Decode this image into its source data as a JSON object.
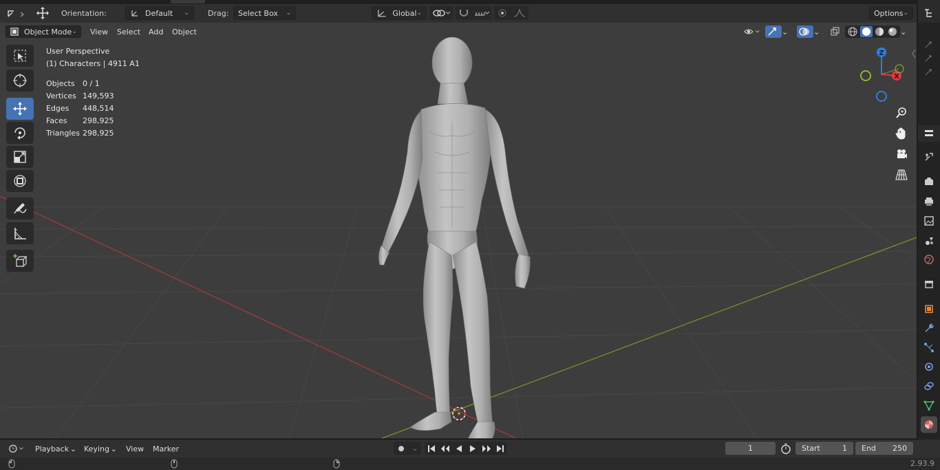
{
  "header": {
    "orientation_label": "Orientation:",
    "orientation_value": "Default",
    "drag_label": "Drag:",
    "drag_value": "Select Box",
    "transform_space": "Global",
    "options_label": "Options"
  },
  "viewport_header": {
    "mode": "Object Mode",
    "menus": [
      "View",
      "Select",
      "Add",
      "Object"
    ]
  },
  "overlay": {
    "view_name": "User Perspective",
    "collection": "(1) Characters | 4911 A1",
    "stats": [
      {
        "label": "Objects",
        "value": "0 / 1"
      },
      {
        "label": "Vertices",
        "value": "149,593"
      },
      {
        "label": "Edges",
        "value": "448,514"
      },
      {
        "label": "Faces",
        "value": "298,925"
      },
      {
        "label": "Triangles",
        "value": "298,925"
      }
    ]
  },
  "gizmo": {
    "z_label": "Z",
    "x_label": "X",
    "colors": {
      "x": "#e8334a",
      "y": "#8bb82b",
      "z": "#2b7fe0"
    }
  },
  "toolbar": {
    "tools": [
      "select-box-tool",
      "cursor-tool",
      "move-tool",
      "rotate-tool",
      "scale-tool",
      "transform-tool",
      "annotate-tool",
      "measure-tool",
      "add-cube-tool"
    ],
    "active_tool": "move-tool"
  },
  "timeline": {
    "menus": [
      "Playback",
      "Keying",
      "View",
      "Marker"
    ],
    "current_frame": "1",
    "start_label": "Start",
    "start_value": "1",
    "end_label": "End",
    "end_value": "250"
  },
  "status": {
    "version": "2.93.9"
  },
  "colors": {
    "accent": "#4772b3",
    "viewport_bg": "#3d3d3d",
    "header_bg": "#303030",
    "x_axis": "#a83a3a",
    "y_axis": "#7f9630"
  }
}
